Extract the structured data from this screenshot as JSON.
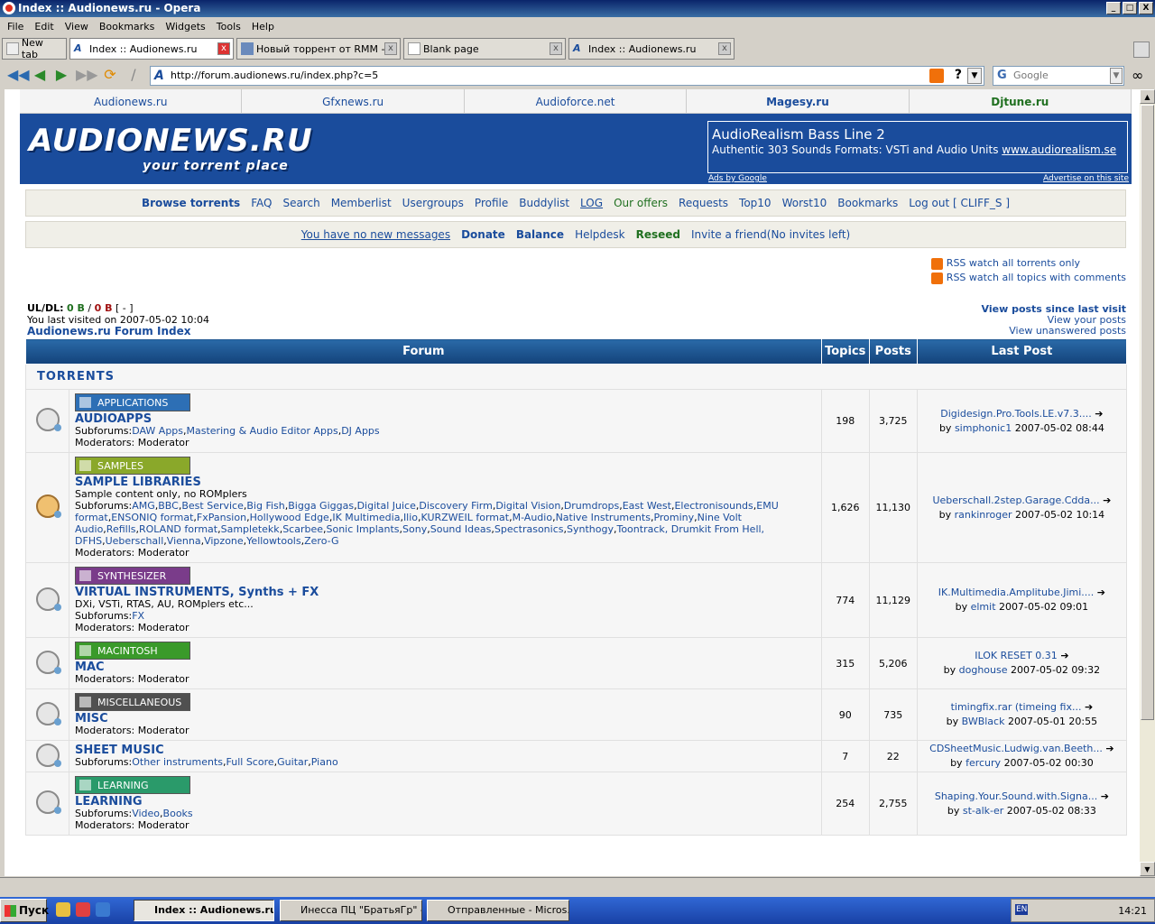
{
  "window": {
    "title": "Index :: Audionews.ru - Opera"
  },
  "menu": [
    "File",
    "Edit",
    "View",
    "Bookmarks",
    "Widgets",
    "Tools",
    "Help"
  ],
  "tabs": [
    {
      "label": "New tab"
    },
    {
      "label": "Index :: Audionews.ru"
    },
    {
      "label": "Новый торрент от RMM -..."
    },
    {
      "label": "Blank page"
    },
    {
      "label": "Index :: Audionews.ru"
    }
  ],
  "address": {
    "url": "http://forum.audionews.ru/index.php?c=5",
    "search_placeholder": "Google"
  },
  "sites": [
    "Audionews.ru",
    "Gfxnews.ru",
    "Audioforce.net",
    "Magesy.ru",
    "Djtune.ru"
  ],
  "logo": {
    "main": "AUDIONEWS.RU",
    "tag": "your torrent place"
  },
  "ad": {
    "title": "AudioRealism Bass Line 2",
    "desc": "Authentic 303 Sounds Formats: VSTi and Audio Units",
    "link": "www.audiorealism.se",
    "left": "Ads by Google",
    "right": "Advertise on this site"
  },
  "nav1": [
    "Browse torrents",
    "FAQ",
    "Search",
    "Memberlist",
    "Usergroups",
    "Profile",
    "Buddylist",
    "LOG",
    "Our offers",
    "Requests",
    "Top10",
    "Worst10",
    "Bookmarks",
    "Log out [ CLIFF_S ]"
  ],
  "nav2": [
    "You have no new messages",
    "Donate",
    "Balance",
    "Helpdesk",
    "Reseed",
    "Invite a friend(No invites left)"
  ],
  "rss": [
    "RSS watch all torrents only",
    "RSS watch all topics with comments"
  ],
  "uldl": {
    "label": "UL/DL:",
    "ul": "0 B",
    "sep": "/",
    "dl": "0 B",
    "extra": "[ - ]"
  },
  "last_visit": "You last visited on 2007-05-02 10:04",
  "forum_index": "Audionews.ru Forum Index",
  "right_links": [
    "View posts since last visit",
    "View your posts",
    "View unanswered posts"
  ],
  "table": {
    "headers": [
      "Forum",
      "Topics",
      "Posts",
      "Last Post"
    ],
    "category": "TORRENTS"
  },
  "forums": [
    {
      "badge": "APPLICATIONS",
      "badge_color": "#2d6fb5",
      "name": "AUDIOAPPS",
      "desc": "",
      "subforums_label": "Subforums:",
      "subforums": [
        "DAW Apps",
        "Mastering & Audio Editor Apps",
        "DJ Apps"
      ],
      "mods": "Moderators: Moderator",
      "topics": "198",
      "posts": "3,725",
      "last_title": "Digidesign.Pro.Tools.LE.v7.3....",
      "last_by": "by",
      "last_user": "simphonic1",
      "last_date": "2007-05-02 08:44",
      "new": false
    },
    {
      "badge": "SAMPLES",
      "badge_color": "#8aa82a",
      "name": "SAMPLE LIBRARIES",
      "desc": "Sample content only, no ROMplers",
      "subforums_label": "Subforums:",
      "subforums": [
        "AMG",
        "BBC",
        "Best Service",
        "Big Fish",
        "Bigga Giggas",
        "Digital Juice",
        "Discovery Firm",
        "Digital Vision",
        "Drumdrops",
        "East West",
        "Electronisounds",
        "EMU format",
        "ENSONIQ format",
        "FxPansion",
        "Hollywood Edge",
        "IK Multimedia",
        "Ilio",
        "KURZWEIL format",
        "M-Audio",
        "Native Instruments",
        "Prominy",
        "Nine Volt Audio",
        "Refills",
        "ROLAND format",
        "Sampletekk",
        "Scarbee",
        "Sonic Implants",
        "Sony",
        "Sound Ideas",
        "Spectrasonics",
        "Synthogy",
        "Toontrack, Drumkit From Hell, DFHS",
        "Ueberschall",
        "Vienna",
        "Vipzone",
        "Yellowtools",
        "Zero-G"
      ],
      "mods": "Moderators: Moderator",
      "topics": "1,626",
      "posts": "11,130",
      "last_title": "Ueberschall.2step.Garage.Cdda...",
      "last_by": "by",
      "last_user": "rankinroger",
      "last_date": "2007-05-02 10:14",
      "new": true
    },
    {
      "badge": "SYNTHESIZER",
      "badge_color": "#7a3c8a",
      "name": "VIRTUAL INSTRUMENTS, Synths + FX",
      "desc": "DXi, VSTi, RTAS, AU, ROMplers etc...",
      "subforums_label": "Subforums:",
      "subforums": [
        "FX"
      ],
      "mods": "Moderators: Moderator",
      "topics": "774",
      "posts": "11,129",
      "last_title": "IK.Multimedia.Amplitube.Jimi....",
      "last_by": "by",
      "last_user": "elmit",
      "last_date": "2007-05-02 09:01",
      "new": false
    },
    {
      "badge": "MACINTOSH",
      "badge_color": "#3a9a2a",
      "name": "MAC",
      "desc": "",
      "subforums_label": "",
      "subforums": [],
      "mods": "Moderators: Moderator",
      "topics": "315",
      "posts": "5,206",
      "last_title": "ILOK RESET 0.31",
      "last_by": "by",
      "last_user": "doghouse",
      "last_date": "2007-05-02 09:32",
      "new": false
    },
    {
      "badge": "MISCELLANEOUS",
      "badge_color": "#505050",
      "name": "MISC",
      "desc": "",
      "subforums_label": "",
      "subforums": [],
      "mods": "Moderators: Moderator",
      "topics": "90",
      "posts": "735",
      "last_title": "timingfix.rar (timeing fix...",
      "last_by": "by",
      "last_user": "BWBlack",
      "last_date": "2007-05-01 20:55",
      "new": false
    },
    {
      "badge": "",
      "badge_color": "",
      "name": "SHEET MUSIC",
      "desc": "",
      "subforums_label": "Subforums:",
      "subforums": [
        "Other instruments",
        "Full Score",
        "Guitar",
        "Piano"
      ],
      "mods": "",
      "topics": "7",
      "posts": "22",
      "last_title": "CDSheetMusic.Ludwig.van.Beeth...",
      "last_by": "by",
      "last_user": "fercury",
      "last_date": "2007-05-02 00:30",
      "new": false
    },
    {
      "badge": "LEARNING",
      "badge_color": "#2a9a6a",
      "name": "LEARNING",
      "desc": "",
      "subforums_label": "Subforums:",
      "subforums": [
        "Video",
        "Books"
      ],
      "mods": "Moderators: Moderator",
      "topics": "254",
      "posts": "2,755",
      "last_title": "Shaping.Your.Sound.with.Signa...",
      "last_by": "by",
      "last_user": "st-alk-er",
      "last_date": "2007-05-02 08:33",
      "new": false
    }
  ],
  "taskbar": {
    "start": "Пуск",
    "items": [
      "Index :: Audionews.ru...",
      "Инесса ПЦ \"БратьяГр\" -...",
      "Отправленные - Micros..."
    ],
    "lang": "EN",
    "time": "14:21"
  }
}
